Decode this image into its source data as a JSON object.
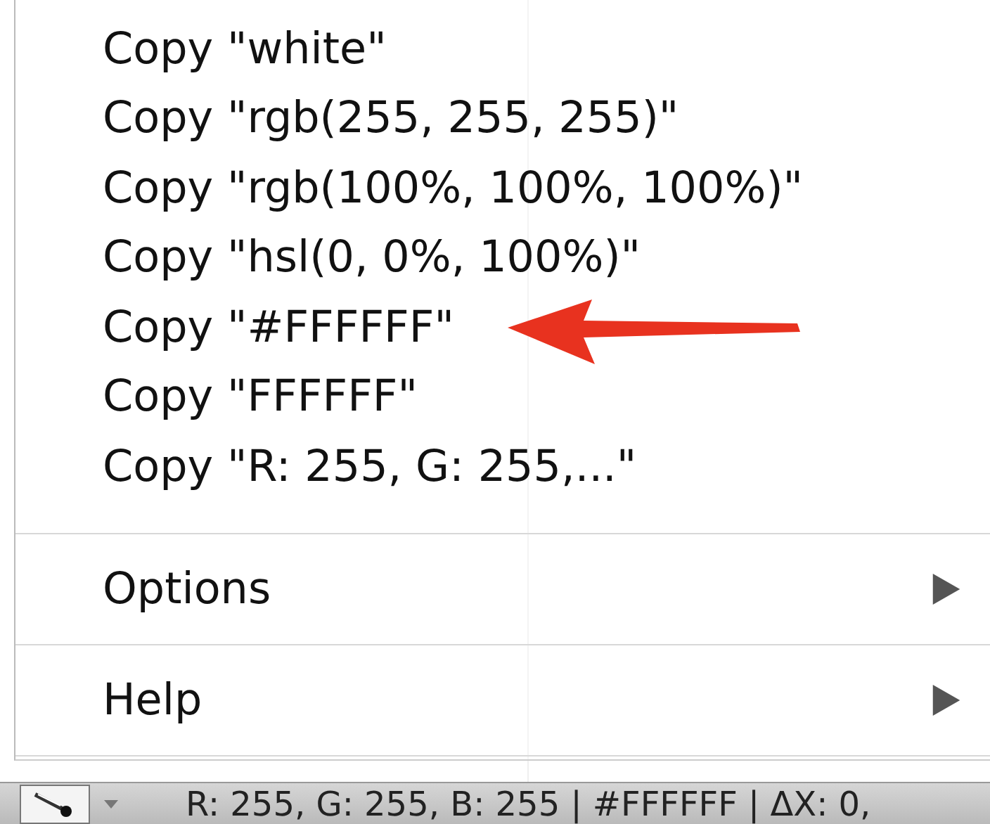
{
  "menu": {
    "copy_items": [
      {
        "label": "Copy \"white\""
      },
      {
        "label": "Copy \"rgb(255, 255, 255)\""
      },
      {
        "label": "Copy \"rgb(100%, 100%, 100%)\""
      },
      {
        "label": "Copy \"hsl(0, 0%, 100%)\""
      },
      {
        "label": "Copy \"#FFFFFF\"",
        "annotated": true
      },
      {
        "label": "Copy \"FFFFFF\""
      },
      {
        "label": "Copy \"R: 255, G: 255,...\""
      }
    ],
    "submenus": [
      {
        "label": "Options"
      },
      {
        "label": "Help"
      }
    ]
  },
  "status_bar": {
    "readout": "R: 255, G: 255, B: 255 | #FFFFFF | ΔX: 0,"
  }
}
